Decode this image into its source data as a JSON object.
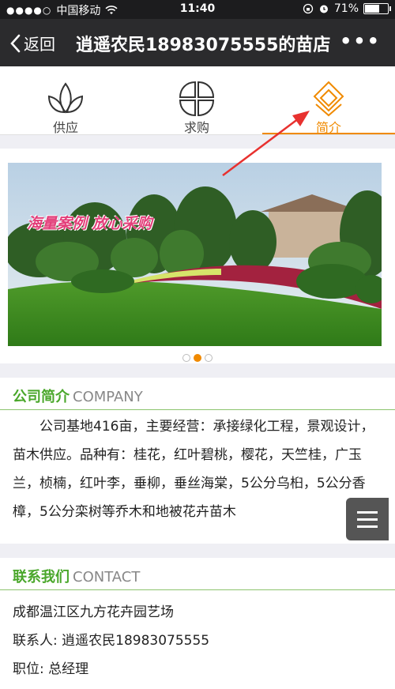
{
  "status": {
    "carrier": "中国移动",
    "signal_dots": "●●●●○",
    "time": "11:40",
    "battery": "71%",
    "battery_level": 0.71
  },
  "nav": {
    "back_label": "返回",
    "title": "逍遥农民18983075555的苗店",
    "more": "•••"
  },
  "tabs": [
    {
      "label": "供应",
      "icon": "leaf-icon",
      "active": false
    },
    {
      "label": "求购",
      "icon": "petal-grid-icon",
      "active": false
    },
    {
      "label": "简介",
      "icon": "diamond-icon",
      "active": true
    }
  ],
  "banner": {
    "caption": "海量案例 放心采购",
    "pages": 3,
    "current_page": 2
  },
  "company": {
    "title_cn": "公司简介",
    "title_en": "COMPANY",
    "text": "公司基地416亩，主要经营：承接绿化工程，景观设计，苗木供应。品种有：桂花，红叶碧桃，樱花，天竺桂，广玉兰，桢楠，红叶李，垂柳，垂丝海棠，5公分乌桕，5公分香樟，5公分栾树等乔木和地被花卉苗木"
  },
  "contact": {
    "title_cn": "联系我们",
    "title_en": "CONTACT",
    "address": "成都温江区九方花卉园艺场",
    "person": "联系人: 逍遥农民18983075555",
    "position": "职位: 总经理"
  },
  "colors": {
    "accent": "#f08a00",
    "green": "#4aa72b",
    "annotation_arrow": "#e8312f"
  }
}
